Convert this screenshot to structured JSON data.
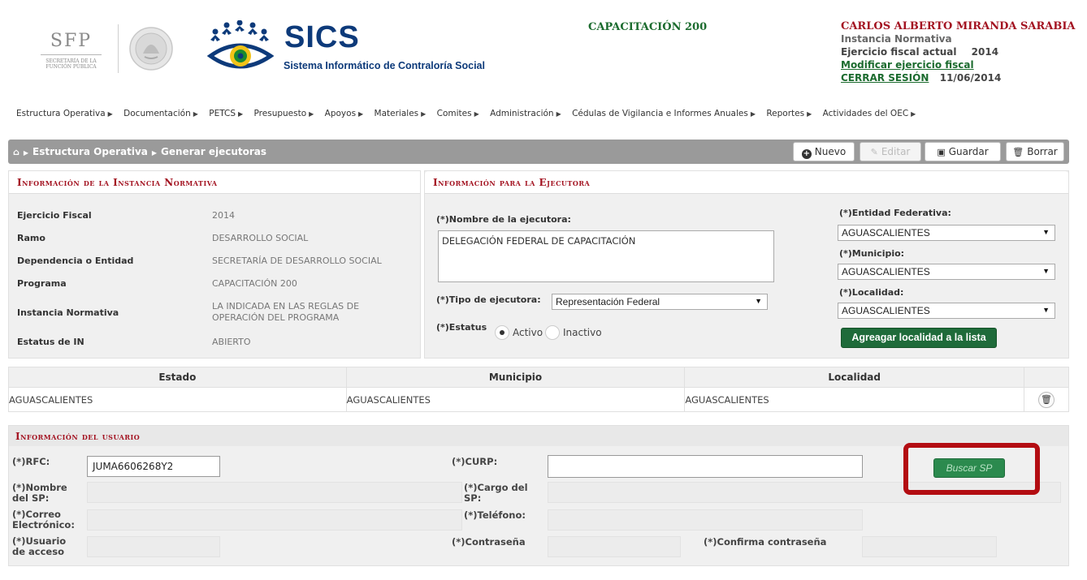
{
  "header": {
    "sfp_logo": "SFP",
    "sfp_subtitle": "SECRETARÍA DE LA FUNCIÓN PÚBLICA",
    "app_title": "SICS",
    "app_subtitle": "Sistema Informático de Contraloría Social",
    "program": "CAPACITACIÓN 200",
    "user_name": "CARLOS ALBERTO MIRANDA SARABIA",
    "user_role": "Instancia Normativa",
    "fiscal_label": "Ejercicio fiscal actual",
    "fiscal_year": "2014",
    "modify_link": "Modificar ejercicio fiscal",
    "logout_link": "CERRAR SESIÓN",
    "date": "11/06/2014"
  },
  "nav": {
    "items": [
      "Estructura Operativa",
      "Documentación",
      "PETCS",
      "Presupuesto",
      "Apoyos",
      "Materiales",
      "Comites",
      "Administración",
      "Cédulas de Vigilancia e Informes Anuales",
      "Reportes",
      "Actividades del OEC"
    ]
  },
  "breadcrumb": {
    "home_icon": "home-icon",
    "section": "Estructura Operativa",
    "page": "Generar ejecutoras"
  },
  "toolbar": {
    "nuevo": "Nuevo",
    "editar": "Editar",
    "guardar": "Guardar",
    "borrar": "Borrar"
  },
  "instancia": {
    "title": "Información de la Instancia Normativa",
    "rows": [
      {
        "label": "Ejercicio Fiscal",
        "value": "2014"
      },
      {
        "label": "Ramo",
        "value": "DESARROLLO SOCIAL"
      },
      {
        "label": "Dependencia o Entidad",
        "value": "SECRETARÍA DE DESARROLLO SOCIAL"
      },
      {
        "label": "Programa",
        "value": "CAPACITACIÓN 200"
      },
      {
        "label": "Instancia Normativa",
        "value": "LA INDICADA EN LAS REGLAS DE OPERACIÓN DEL PROGRAMA"
      },
      {
        "label": "Estatus de IN",
        "value": "ABIERTO"
      }
    ]
  },
  "ejecutora": {
    "title": "Información para la Ejecutora",
    "nombre_label": "(*)Nombre de la ejecutora:",
    "nombre_value": "DELEGACIÓN FEDERAL DE CAPACITACIÓN",
    "tipo_label": "(*)Tipo de ejecutora:",
    "tipo_value": "Representación Federal",
    "estatus_label": "(*)Estatus",
    "activo": "Activo",
    "inactivo": "Inactivo",
    "entidad_label": "(*)Entidad Federativa:",
    "entidad_value": "AGUASCALIENTES",
    "municipio_label": "(*)Municipio:",
    "municipio_value": "AGUASCALIENTES",
    "localidad_label": "(*)Localidad:",
    "localidad_value": "AGUASCALIENTES",
    "agregar_button": "Agreagar localidad a la lista"
  },
  "localidades": {
    "headers": [
      "Estado",
      "Municipio",
      "Localidad"
    ],
    "rows": [
      [
        "AGUASCALIENTES",
        "AGUASCALIENTES",
        "AGUASCALIENTES"
      ]
    ]
  },
  "usuario": {
    "title": "Información del usuario",
    "rfc_label": "(*)RFC:",
    "rfc_value": "JUMA6606268Y2",
    "curp_label": "(*)CURP:",
    "curp_value": "",
    "buscar_button": "Buscar SP",
    "nombre_label": "(*)Nombre del SP:",
    "cargo_label": "(*)Cargo del SP:",
    "correo_label": "(*)Correo Electrónico:",
    "telefono_label": "(*)Teléfono:",
    "usuario_label": "(*)Usuario de acceso",
    "contrasena_label": "(*)Contraseña",
    "confirma_label": "(*)Confirma contraseña"
  },
  "colors": {
    "brand_red": "#a31321",
    "brand_green": "#1f6b3a",
    "sics_blue": "#0d3a7a",
    "highlight_red": "#b30d12"
  }
}
